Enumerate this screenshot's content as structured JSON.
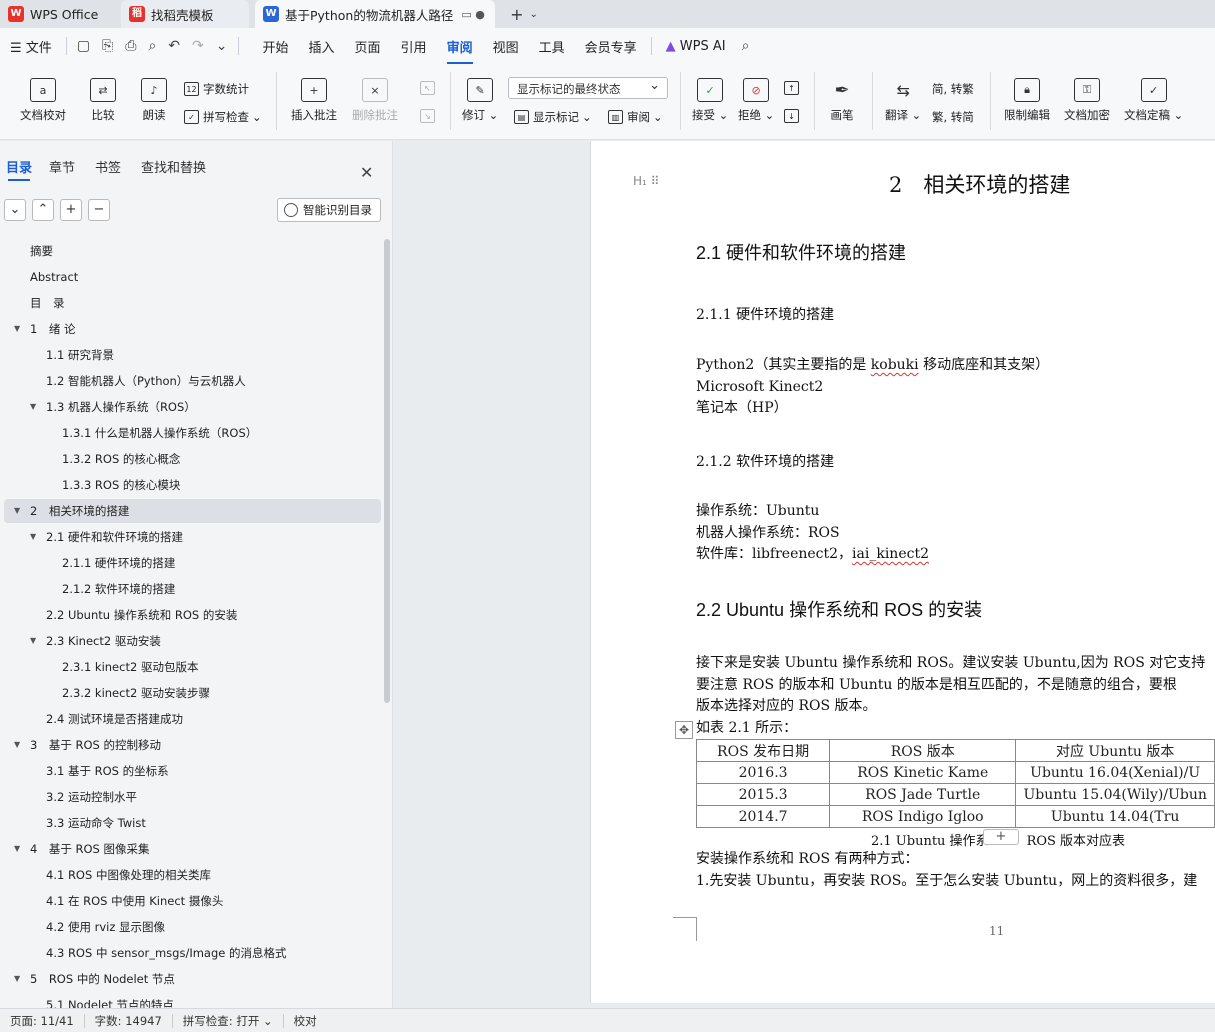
{
  "tabs": [
    {
      "label": "WPS Office"
    },
    {
      "label": "找稻壳模板"
    },
    {
      "label": "基于Python的物流机器人路径"
    }
  ],
  "menu": {
    "file": "文件",
    "items": [
      "开始",
      "插入",
      "页面",
      "引用",
      "审阅",
      "视图",
      "工具",
      "会员专享"
    ],
    "active": "审阅",
    "wps_ai": "WPS AI"
  },
  "ribbon": {
    "proofread": "文档校对",
    "compare": "比较",
    "read_aloud": "朗读",
    "word_count": "字数统计",
    "spell_check": "拼写检查",
    "insert_comment": "插入批注",
    "delete_comment": "删除批注",
    "revise": "修订",
    "status_select": "显示标记的最终状态",
    "show_markup": "显示标记",
    "review": "审阅",
    "accept": "接受",
    "reject": "拒绝",
    "pen": "画笔",
    "translate": "翻译",
    "simp_to_trad": "简, 转繁",
    "trad_to_simp": "繁, 转简",
    "restrict_edit": "限制编辑",
    "encrypt": "文档加密",
    "finalize": "文档定稿"
  },
  "nav": {
    "tabs": [
      "目录",
      "章节",
      "书签",
      "查找和替换"
    ],
    "smart_toc": "智能识别目录",
    "toc": [
      {
        "label": "摘要",
        "level": 0,
        "arrow": false
      },
      {
        "label": "Abstract",
        "level": 0,
        "arrow": false
      },
      {
        "label": "目　录",
        "level": 0,
        "arrow": false
      },
      {
        "label": "1　绪 论",
        "level": 0,
        "arrow": true
      },
      {
        "label": "1.1 研究背景",
        "level": 1,
        "arrow": false
      },
      {
        "label": "1.2 智能机器人（Python）与云机器人",
        "level": 1,
        "arrow": false
      },
      {
        "label": "1.3 机器人操作系统（ROS）",
        "level": 1,
        "arrow": true
      },
      {
        "label": "1.3.1  什么是机器人操作系统（ROS）",
        "level": 2,
        "arrow": false
      },
      {
        "label": "1.3.2 ROS 的核心概念",
        "level": 2,
        "arrow": false
      },
      {
        "label": "1.3.3 ROS 的核心模块",
        "level": 2,
        "arrow": false
      },
      {
        "label": "2　相关环境的搭建",
        "level": 0,
        "arrow": true,
        "selected": true
      },
      {
        "label": "2.1 硬件和软件环境的搭建",
        "level": 1,
        "arrow": true
      },
      {
        "label": "2.1.1 硬件环境的搭建",
        "level": 2,
        "arrow": false
      },
      {
        "label": "2.1.2 软件环境的搭建",
        "level": 2,
        "arrow": false
      },
      {
        "label": "2.2 Ubuntu 操作系统和 ROS 的安装",
        "level": 1,
        "arrow": false
      },
      {
        "label": "2.3 Kinect2 驱动安装",
        "level": 1,
        "arrow": true
      },
      {
        "label": "2.3.1 kinect2 驱动包版本",
        "level": 2,
        "arrow": false
      },
      {
        "label": "2.3.2 kinect2 驱动安装步骤",
        "level": 2,
        "arrow": false
      },
      {
        "label": "2.4  测试环境是否搭建成功",
        "level": 1,
        "arrow": false
      },
      {
        "label": "3　基于 ROS 的控制移动",
        "level": 0,
        "arrow": true
      },
      {
        "label": "3.1  基于 ROS 的坐标系",
        "level": 1,
        "arrow": false
      },
      {
        "label": "3.2  运动控制水平",
        "level": 1,
        "arrow": false
      },
      {
        "label": "3.3 运动命令 Twist",
        "level": 1,
        "arrow": false
      },
      {
        "label": "4　基于 ROS 图像采集",
        "level": 0,
        "arrow": true
      },
      {
        "label": "4.1 ROS 中图像处理的相关类库",
        "level": 1,
        "arrow": false
      },
      {
        "label": "4.1  在 ROS 中使用 Kinect 摄像头",
        "level": 1,
        "arrow": false
      },
      {
        "label": "4.2  使用 rviz 显示图像",
        "level": 1,
        "arrow": false
      },
      {
        "label": "4.3 ROS 中 sensor_msgs/Image 的消息格式",
        "level": 1,
        "arrow": false
      },
      {
        "label": "5　ROS 中的 Nodelet 节点",
        "level": 0,
        "arrow": true
      },
      {
        "label": "5.1 Nodelet 节点的特点",
        "level": 1,
        "arrow": false
      }
    ]
  },
  "doc": {
    "chapter": "2　相关环境的搭建",
    "h2_1": "2.1 硬件和软件环境的搭建",
    "h3_1": "2.1.1 硬件环境的搭建",
    "hw1_a": "Python2（其实主要指的是 ",
    "hw1_b": "kobuki",
    "hw1_c": " 移动底座和其支架）",
    "hw2": "Microsoft Kinect2",
    "hw3": "笔记本（HP）",
    "h3_2": "2.1.2 软件环境的搭建",
    "sw1": "操作系统：Ubuntu",
    "sw2": "机器人操作系统：ROS",
    "sw3_a": "软件库：libfreenect2，",
    "sw3_b": "iai_kinect2",
    "h2_2": "2.2 Ubuntu 操作系统和 ROS 的安装",
    "para1": "接下来是安装 Ubuntu 操作系统和 ROS。建议安装 Ubuntu,因为 ROS 对它支持",
    "para2": "要注意 ROS 的版本和 Ubuntu 的版本是相互匹配的，不是随意的组合，要根",
    "para3": "版本选择对应的 ROS 版本。",
    "para4": "如表 2.1 所示：",
    "table": {
      "headers": [
        "ROS 发布日期",
        "ROS 版本",
        "对应 Ubuntu 版本"
      ],
      "rows": [
        [
          "2016.3",
          "ROS Kinetic Kame",
          "Ubuntu 16.04(Xenial)/U"
        ],
        [
          "2015.3",
          "ROS Jade Turtle",
          "Ubuntu 15.04(Wily)/Ubun"
        ],
        [
          "2014.7",
          "ROS Indigo Igloo",
          "Ubuntu 14.04(Tru"
        ]
      ]
    },
    "caption_a": "2.1 Ubuntu 操作系",
    "caption_b": "ROS 版本对应表",
    "para5": "安装操作系统和 ROS 有两种方式：",
    "para6": "1.先安装 Ubuntu，再安装 ROS。至于怎么安装 Ubuntu，网上的资料很多，建",
    "page_number": "11"
  },
  "status": {
    "page": "页面: 11/41",
    "words": "字数: 14947",
    "spell": "拼写检查: 打开",
    "proof": "校对"
  }
}
